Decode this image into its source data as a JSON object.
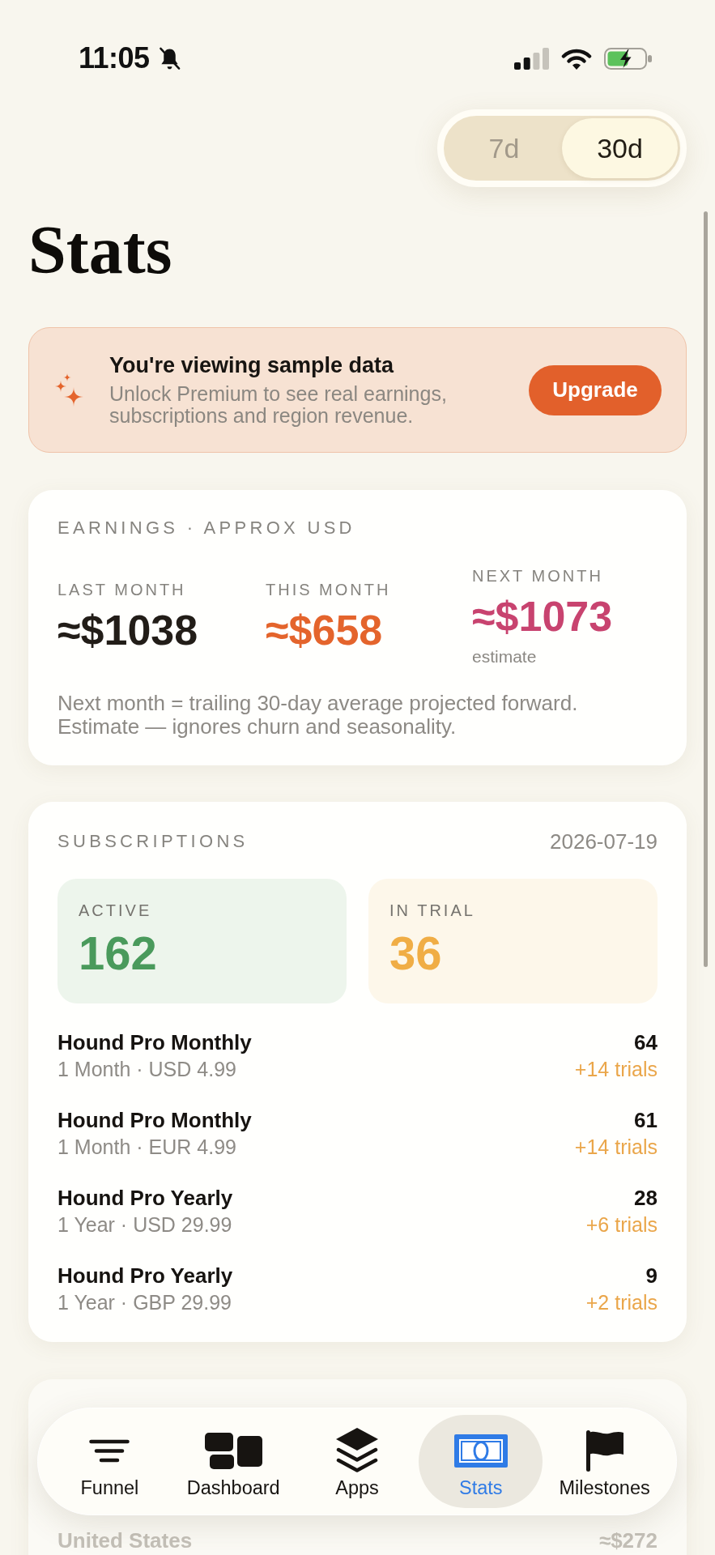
{
  "status_bar": {
    "time": "11:05",
    "silent": true,
    "charging": true
  },
  "period_picker": {
    "options": [
      {
        "label": "7d",
        "selected": false
      },
      {
        "label": "30d",
        "selected": true
      }
    ]
  },
  "title": "Stats",
  "banner": {
    "title": "You're viewing sample data",
    "text": "Unlock Premium to see real earnings, subscriptions and region revenue.",
    "button": "Upgrade"
  },
  "earnings": {
    "heading": "EARNINGS · APPROX USD",
    "metrics": [
      {
        "label": "LAST MONTH",
        "value": "≈$1038",
        "color": "#221d18"
      },
      {
        "label": "THIS MONTH",
        "value": "≈$658",
        "color": "#e4642c"
      },
      {
        "label": "NEXT MONTH",
        "value": "≈$1073",
        "color": "#c8436f",
        "note": "estimate"
      }
    ],
    "footnote": "Next month = trailing 30-day average projected forward. Estimate — ignores churn and seasonality."
  },
  "subscriptions": {
    "heading": "SUBSCRIPTIONS",
    "date": "2026-07-19",
    "totals": [
      {
        "label": "ACTIVE",
        "value": "162",
        "color": "#4a9a5c"
      },
      {
        "label": "IN TRIAL",
        "value": "36",
        "color": "#f0ad45"
      }
    ],
    "products": [
      {
        "name": "Hound Pro Monthly",
        "detail": "1 Month · USD 4.99",
        "count": "64",
        "trials": "+14 trials"
      },
      {
        "name": "Hound Pro Monthly",
        "detail": "1 Month · EUR 4.99",
        "count": "61",
        "trials": "+14 trials"
      },
      {
        "name": "Hound Pro Yearly",
        "detail": "1 Year · USD 29.99",
        "count": "28",
        "trials": "+6 trials"
      },
      {
        "name": "Hound Pro Yearly",
        "detail": "1 Year · GBP 29.99",
        "count": "9",
        "trials": "+2 trials"
      }
    ]
  },
  "regions": {
    "rows": [
      {
        "name": "United States",
        "value": "≈$272"
      }
    ]
  },
  "tab_bar": {
    "items": [
      {
        "label": "Funnel",
        "selected": false
      },
      {
        "label": "Dashboard",
        "selected": false
      },
      {
        "label": "Apps",
        "selected": false
      },
      {
        "label": "Stats",
        "selected": true
      },
      {
        "label": "Milestones",
        "selected": false
      }
    ]
  }
}
